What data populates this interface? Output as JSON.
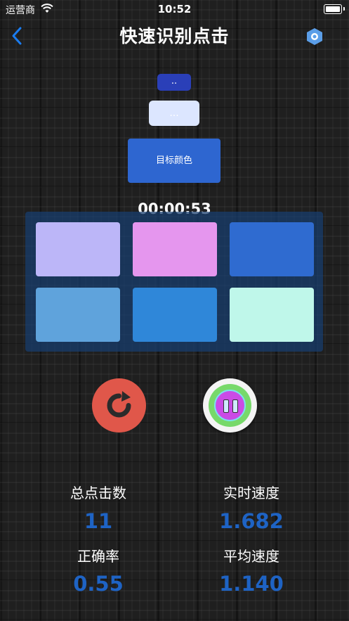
{
  "status_bar": {
    "carrier": "运营商",
    "time": "10:52"
  },
  "nav": {
    "title": "快速识别点击",
    "back_icon": "chevron-left-icon",
    "settings_icon": "hexagon-settings-icon"
  },
  "top_buttons": {
    "small_label": "..",
    "mid_label": "...",
    "target_label": "目标颜色"
  },
  "timer": "00:00:53",
  "tiles": [
    {
      "color": "#bcb6f8"
    },
    {
      "color": "#e596ee"
    },
    {
      "color": "#2f6bd0"
    },
    {
      "color": "#5fa3dc"
    },
    {
      "color": "#2f87d9"
    },
    {
      "color": "#bff7ea"
    }
  ],
  "controls": {
    "restart_icon": "restart-icon",
    "pause_icon": "pause-icon"
  },
  "stats": {
    "total_clicks_label": "总点击数",
    "total_clicks_value": "11",
    "realtime_speed_label": "实时速度",
    "realtime_speed_value": "1.682",
    "accuracy_label": "正确率",
    "accuracy_value": "0.55",
    "avg_speed_label": "平均速度",
    "avg_speed_value": "1.140"
  },
  "colors": {
    "accent_blue": "#1e63c4",
    "restart_red": "#e0574a",
    "nav_blue": "#1a7cf0"
  }
}
